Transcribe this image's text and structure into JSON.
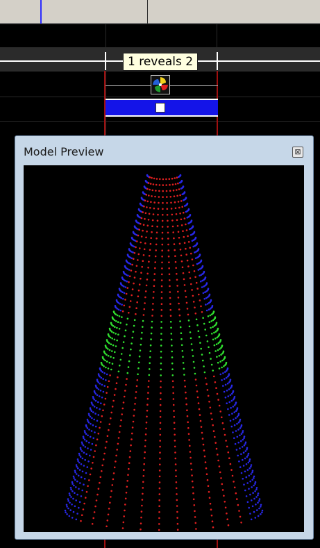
{
  "timeline": {
    "effect_label": "1 reveals 2"
  },
  "preview": {
    "title": "Model Preview",
    "close_glyph": "⊠"
  },
  "colors": {
    "ruler_bg": "#d4d0c8",
    "playhead": "#2c2cff",
    "effect_border": "#a01010",
    "blue_bar": "#1414e8",
    "label_bg": "#ffffe0",
    "preview_frame": "#c6d7e8",
    "dot_red": "#e02020",
    "dot_blue": "#2828e8",
    "dot_green": "#30e030"
  },
  "icons": {
    "effect_icon": "pinwheel-effect-icon",
    "close_icon": "close-icon"
  }
}
